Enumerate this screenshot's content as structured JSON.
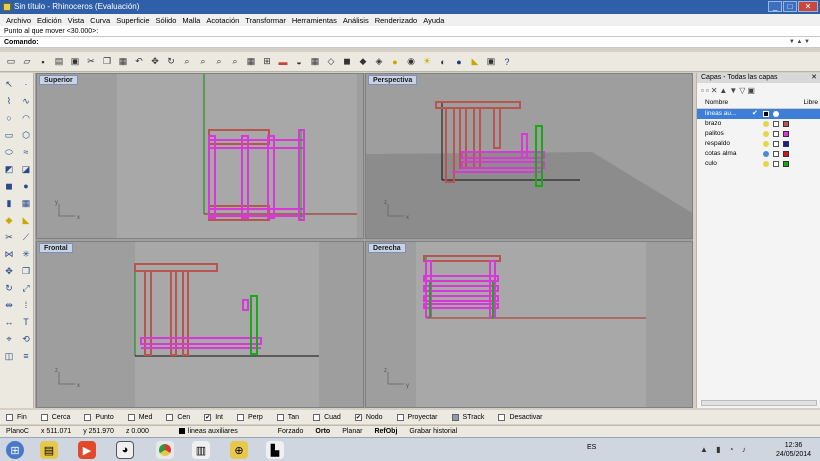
{
  "window": {
    "title": "Sin título - Rhinoceros (Evaluación)",
    "buttons": [
      "_",
      "□",
      "✕"
    ]
  },
  "menu": [
    "Archivo",
    "Edición",
    "Vista",
    "Curva",
    "Superficie",
    "Sólido",
    "Malla",
    "Acotación",
    "Transformar",
    "Herramientas",
    "Análisis",
    "Renderizado",
    "Ayuda"
  ],
  "command": {
    "history": "Punto al que mover <30.000>:",
    "label": "Comando:",
    "value": ""
  },
  "toolbar_icons": [
    "new-icon",
    "open-icon",
    "save-icon",
    "print-icon",
    "import-icon",
    "cut-icon",
    "copy-icon",
    "paste-icon",
    "undo-icon",
    "pan-icon",
    "rotate-icon",
    "zoom-icon",
    "zoom-window-icon",
    "zoom-extents-icon",
    "zoom-selected-icon",
    "viewport-layout-icon",
    "four-view-icon",
    "car-icon",
    "camera-icon",
    "grid-icon",
    "perspective-icon",
    "shaded-icon",
    "rendered-icon",
    "ghosted-icon",
    "bulb-icon",
    "material-icon",
    "sun-icon",
    "render-icon",
    "sphere-icon",
    "properties-icon",
    "options-icon",
    "help-icon"
  ],
  "viewports": {
    "top": "Superior",
    "perspective": "Perspectiva",
    "front": "Frontal",
    "right": "Derecha"
  },
  "layers": {
    "panel_title": "Capas - Todas las capas",
    "col_name": "Nombre",
    "col_free": "Libre",
    "rows": [
      {
        "name": "lineas au...",
        "color": "#000000",
        "current": true
      },
      {
        "name": "brazo",
        "color": "#b8554e",
        "current": false
      },
      {
        "name": "palitos",
        "color": "#d838d8",
        "current": false
      },
      {
        "name": "respaldo",
        "color": "#1a1a9a",
        "current": false
      },
      {
        "name": "cotas alma",
        "color": "#d01818",
        "current": false
      },
      {
        "name": "culo",
        "color": "#18a818",
        "current": false
      }
    ]
  },
  "osnaps": [
    {
      "label": "Fin",
      "checked": false
    },
    {
      "label": "Cerca",
      "checked": false
    },
    {
      "label": "Punto",
      "checked": false
    },
    {
      "label": "Med",
      "checked": false
    },
    {
      "label": "Cen",
      "checked": false
    },
    {
      "label": "Int",
      "checked": true
    },
    {
      "label": "Perp",
      "checked": false
    },
    {
      "label": "Tan",
      "checked": false
    },
    {
      "label": "Cuad",
      "checked": false
    },
    {
      "label": "Nodo",
      "checked": true
    },
    {
      "label": "Proyectar",
      "checked": false
    },
    {
      "label": "STrack",
      "checked": false
    },
    {
      "label": "Desactivar",
      "checked": false
    }
  ],
  "status": {
    "plane": "PlanoC",
    "x": "x 511.071",
    "y": "y 251.970",
    "z": "z 0.000",
    "layer": "lineas auxiliares",
    "modes": [
      "Forzado",
      "Orto",
      "Planar",
      "RefObj",
      "Grabar historial"
    ]
  },
  "taskbar": {
    "lang": "ES",
    "time": "12:36",
    "date": "24/05/2014"
  },
  "colors": {
    "accent": "#2e5fa8",
    "magenta": "#d838d8",
    "brown": "#b8554e",
    "green": "#18a818"
  }
}
